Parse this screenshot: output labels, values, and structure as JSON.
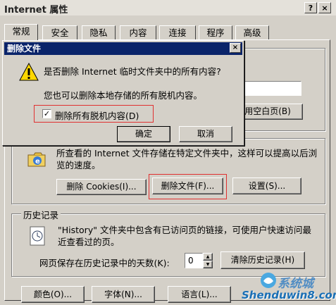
{
  "window": {
    "title": "Internet 属性",
    "help_label": "?",
    "close_label": "×"
  },
  "tabs": [
    "常规",
    "安全",
    "隐私",
    "内容",
    "连接",
    "程序",
    "高级"
  ],
  "homepage": {
    "blank_button": "用空白页(B)"
  },
  "temp_files": {
    "description": "所查看的 Internet 文件存储在特定文件夹中，这样可以提高以后浏览的速度。",
    "delete_cookies": "删除 Cookies(I)...",
    "delete_files": "删除文件(F)...",
    "settings": "设置(S)..."
  },
  "history": {
    "group_label": "历史记录",
    "description": "\"History\" 文件夹中包含有已访问页的链接，可使用户快速访问最近查看过的页。",
    "days_label": "网页保存在历史记录中的天数(K):",
    "days_value": "0",
    "clear_button": "清除历史记录(H)"
  },
  "bottom": {
    "colors": "颜色(O)...",
    "fonts": "字体(N)...",
    "languages": "语言(L)..."
  },
  "dialog": {
    "title": "删除文件",
    "question": "是否删除 Internet 临时文件夹中的所有内容?",
    "info": "您也可以删除本地存储的所有脱机内容。",
    "checkbox_label": "删除所有脱机内容(D)",
    "checkbox_checked": true,
    "ok": "确定",
    "cancel": "取消",
    "close_label": "×",
    "check_mark": "✓"
  },
  "watermark": {
    "main": "Shenduwin8.com",
    "sub": "系统城"
  },
  "colors": {
    "title_bar": "#0a246a",
    "highlight_box": "#e03030",
    "window_bg": "#d4d0c8"
  }
}
